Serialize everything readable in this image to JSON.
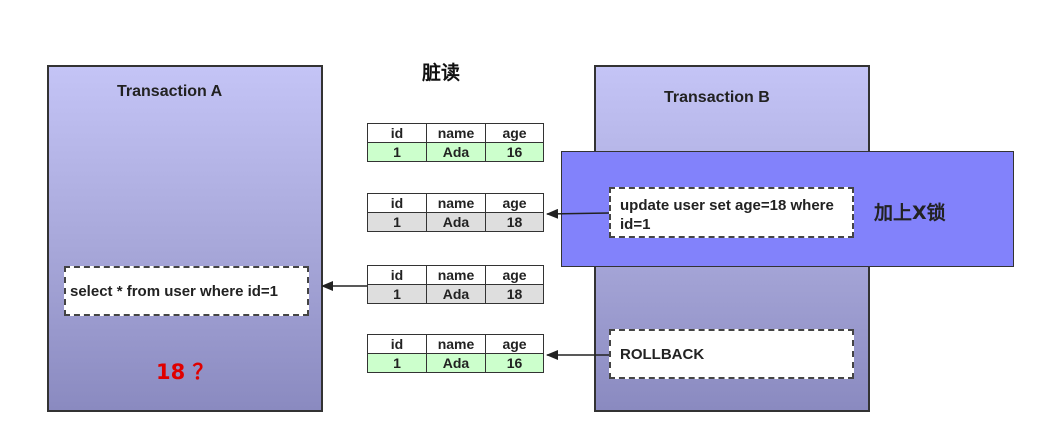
{
  "title": "脏读",
  "transaction_a": {
    "title": "Transaction A",
    "query": "select * from user where id=1",
    "result": "18 ？"
  },
  "transaction_b": {
    "title": "Transaction B",
    "update": "update user set age=18 where id=1",
    "lock_label": "加上X锁",
    "rollback": "ROLLBACK"
  },
  "tables": [
    {
      "headers": [
        "id",
        "name",
        "age"
      ],
      "row": [
        "1",
        "Ada",
        "16"
      ],
      "color": "#ccffcc"
    },
    {
      "headers": [
        "id",
        "name",
        "age"
      ],
      "row": [
        "1",
        "Ada",
        "18"
      ],
      "color": "#dedede"
    },
    {
      "headers": [
        "id",
        "name",
        "age"
      ],
      "row": [
        "1",
        "Ada",
        "18"
      ],
      "color": "#dedede"
    },
    {
      "headers": [
        "id",
        "name",
        "age"
      ],
      "row": [
        "1",
        "Ada",
        "16"
      ],
      "color": "#ccffcc"
    }
  ],
  "colors": {
    "lock_box": "#8282fb",
    "panel_gradient_top": "#c4c4f6",
    "panel_gradient_bottom": "#8a8ac0",
    "result_text": "#e00000"
  }
}
